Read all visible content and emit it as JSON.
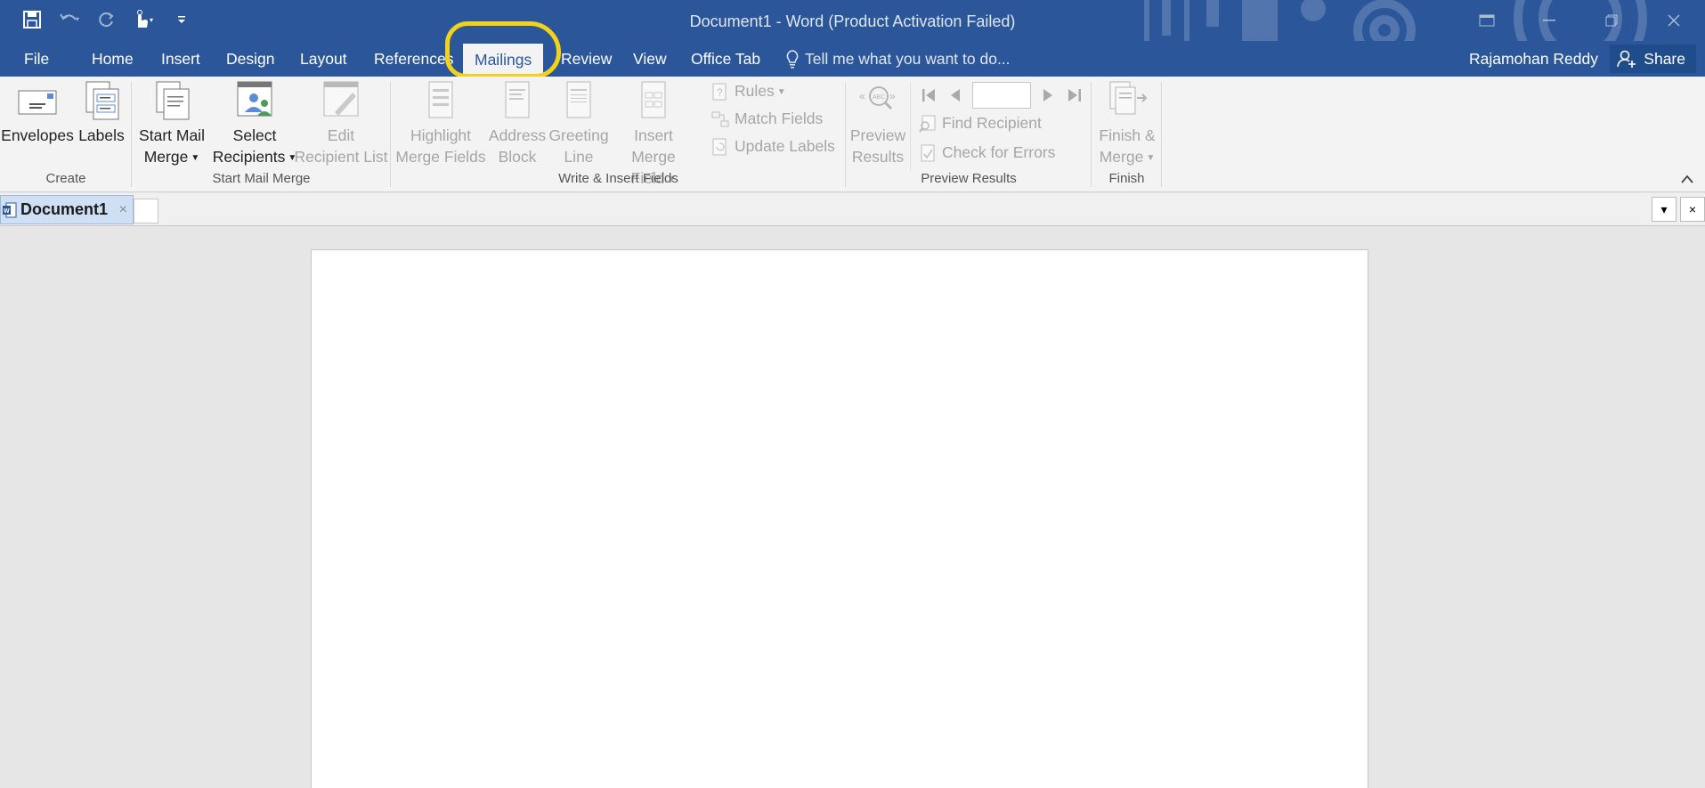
{
  "window": {
    "title": "Document1 - Word (Product Activation Failed)"
  },
  "qat": {
    "save_icon": "save-icon",
    "undo_icon": "undo-icon",
    "redo_icon": "redo-icon",
    "touch_icon": "touch-mode-icon",
    "customize_icon": "customize-qat-icon"
  },
  "tabs": [
    {
      "label": "File"
    },
    {
      "label": "Home"
    },
    {
      "label": "Insert"
    },
    {
      "label": "Design"
    },
    {
      "label": "Layout"
    },
    {
      "label": "References"
    },
    {
      "label": "Mailings"
    },
    {
      "label": "Review"
    },
    {
      "label": "View"
    },
    {
      "label": "Office Tab"
    }
  ],
  "tell_me": "Tell me what you want to do...",
  "user": "Rajamohan Reddy",
  "share": "Share",
  "ribbon": {
    "create": {
      "label": "Create",
      "envelopes": "Envelopes",
      "labels": "Labels"
    },
    "start": {
      "label": "Start Mail Merge",
      "start_mail_merge_1": "Start Mail",
      "start_mail_merge_2": "Merge",
      "select_recipients_1": "Select",
      "select_recipients_2": "Recipients",
      "edit_list_1": "Edit",
      "edit_list_2": "Recipient List"
    },
    "write": {
      "label": "Write & Insert Fields",
      "highlight_1": "Highlight",
      "highlight_2": "Merge Fields",
      "address_1": "Address",
      "address_2": "Block",
      "greeting_1": "Greeting",
      "greeting_2": "Line",
      "insert_field_1": "Insert Merge",
      "insert_field_2": "Field",
      "rules": "Rules",
      "match_fields": "Match Fields",
      "update_labels": "Update Labels"
    },
    "preview": {
      "label": "Preview Results",
      "preview_1": "Preview",
      "preview_2": "Results",
      "find_recipient": "Find Recipient",
      "check_errors": "Check for Errors",
      "record_value": ""
    },
    "finish": {
      "label": "Finish",
      "finish_1": "Finish &",
      "finish_2": "Merge"
    }
  },
  "doc_tab": {
    "name": "Document1",
    "close": "×"
  },
  "doc_tab_controls": {
    "dropdown": "▾",
    "close": "×"
  },
  "colors": {
    "ribbon_blue": "#2b579a",
    "highlight_yellow": "#f5d21a"
  }
}
